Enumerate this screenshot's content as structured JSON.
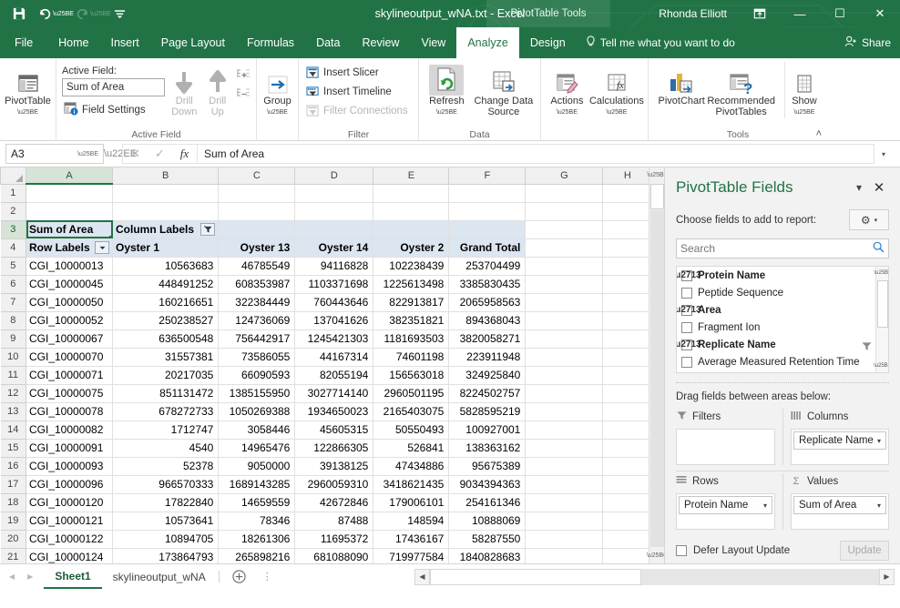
{
  "titlebar": {
    "quick_access": [
      {
        "name": "save-icon",
        "glyph": "💾",
        "dim": false
      },
      {
        "name": "undo-icon",
        "glyph": "↶",
        "dim": false
      },
      {
        "name": "redo-icon",
        "glyph": "↷",
        "dim": true
      },
      {
        "name": "customize-qat-icon",
        "glyph": "☰",
        "dim": false
      }
    ],
    "document_title": "skylineoutput_wNA.txt  -  Excel",
    "contextual_tools": "PivotTable Tools",
    "user_name": "Rhonda Elliott",
    "ribbon_display_icon": "⬒",
    "minimize": "—",
    "maximize": "☐",
    "close": "✕"
  },
  "ribbon_tabs": {
    "items": [
      {
        "label": "File",
        "active": false
      },
      {
        "label": "Home",
        "active": false
      },
      {
        "label": "Insert",
        "active": false
      },
      {
        "label": "Page Layout",
        "active": false
      },
      {
        "label": "Formulas",
        "active": false
      },
      {
        "label": "Data",
        "active": false
      },
      {
        "label": "Review",
        "active": false
      },
      {
        "label": "View",
        "active": false
      },
      {
        "label": "Analyze",
        "active": true
      },
      {
        "label": "Design",
        "active": false
      }
    ],
    "tell_me": "Tell me what you want to do",
    "share": "Share"
  },
  "ribbon": {
    "groups": [
      {
        "title": "",
        "name": "pivottable-group"
      },
      {
        "title": "Active Field",
        "name": "active-field-group"
      },
      {
        "title": "",
        "name": "group-group"
      },
      {
        "title": "Filter",
        "name": "filter-group"
      },
      {
        "title": "Data",
        "name": "data-group"
      },
      {
        "title": "",
        "name": "actions-group"
      },
      {
        "title": "Tools",
        "name": "tools-group"
      }
    ],
    "pivottable_button": "PivotTable",
    "active_field_label": "Active Field:",
    "active_field_value": "Sum of Area",
    "field_settings": "Field Settings",
    "drill_down": "Drill\nDown",
    "drill_down_l1": "Drill",
    "drill_down_l2": "Down",
    "drill_up_l1": "Drill",
    "drill_up_l2": "Up",
    "group_button": "Group",
    "insert_slicer": "Insert Slicer",
    "insert_timeline": "Insert Timeline",
    "filter_connections": "Filter Connections",
    "refresh": "Refresh",
    "change_data_source_l1": "Change Data",
    "change_data_source_l2": "Source",
    "actions": "Actions",
    "calculations": "Calculations",
    "pivotchart": "PivotChart",
    "recommended_l1": "Recommended",
    "recommended_l2": "PivotTables",
    "show": "Show",
    "collapse_icon": "˄"
  },
  "formula_bar": {
    "name_box_value": "A3",
    "cancel_icon": "✕",
    "enter_icon": "✓",
    "fx_icon": "fx",
    "formula_value": "Sum of Area",
    "dropdown_icon": "▾"
  },
  "grid": {
    "columns": [
      "A",
      "B",
      "C",
      "D",
      "E",
      "F",
      "G",
      "H"
    ],
    "selected_column": "A",
    "selected_row": 3,
    "active_cell": "A3",
    "rows": [
      {
        "n": 1,
        "cells": [
          "",
          "",
          "",
          "",
          "",
          "",
          "",
          ""
        ]
      },
      {
        "n": 2,
        "cells": [
          "",
          "",
          "",
          "",
          "",
          "",
          "",
          ""
        ]
      },
      {
        "n": 3,
        "cells": [
          "Sum of Area",
          "Column Labels",
          "",
          "",
          "",
          "",
          "",
          ""
        ]
      },
      {
        "n": 4,
        "cells": [
          "Row Labels",
          "Oyster 1",
          "Oyster 13",
          "Oyster 14",
          "Oyster 2",
          "Grand Total",
          "",
          ""
        ]
      },
      {
        "n": 5,
        "cells": [
          "CGI_10000013",
          "10563683",
          "46785549",
          "94116828",
          "102238439",
          "253704499",
          "",
          ""
        ]
      },
      {
        "n": 6,
        "cells": [
          "CGI_10000045",
          "448491252",
          "608353987",
          "1103371698",
          "1225613498",
          "3385830435",
          "",
          ""
        ]
      },
      {
        "n": 7,
        "cells": [
          "CGI_10000050",
          "160216651",
          "322384449",
          "760443646",
          "822913817",
          "2065958563",
          "",
          ""
        ]
      },
      {
        "n": 8,
        "cells": [
          "CGI_10000052",
          "250238527",
          "124736069",
          "137041626",
          "382351821",
          "894368043",
          "",
          ""
        ]
      },
      {
        "n": 9,
        "cells": [
          "CGI_10000067",
          "636500548",
          "756442917",
          "1245421303",
          "1181693503",
          "3820058271",
          "",
          ""
        ]
      },
      {
        "n": 10,
        "cells": [
          "CGI_10000070",
          "31557381",
          "73586055",
          "44167314",
          "74601198",
          "223911948",
          "",
          ""
        ]
      },
      {
        "n": 11,
        "cells": [
          "CGI_10000071",
          "20217035",
          "66090593",
          "82055194",
          "156563018",
          "324925840",
          "",
          ""
        ]
      },
      {
        "n": 12,
        "cells": [
          "CGI_10000075",
          "851131472",
          "1385155950",
          "3027714140",
          "2960501195",
          "8224502757",
          "",
          ""
        ]
      },
      {
        "n": 13,
        "cells": [
          "CGI_10000078",
          "678272733",
          "1050269388",
          "1934650023",
          "2165403075",
          "5828595219",
          "",
          ""
        ]
      },
      {
        "n": 14,
        "cells": [
          "CGI_10000082",
          "1712747",
          "3058446",
          "45605315",
          "50550493",
          "100927001",
          "",
          ""
        ]
      },
      {
        "n": 15,
        "cells": [
          "CGI_10000091",
          "4540",
          "14965476",
          "122866305",
          "526841",
          "138363162",
          "",
          ""
        ]
      },
      {
        "n": 16,
        "cells": [
          "CGI_10000093",
          "52378",
          "9050000",
          "39138125",
          "47434886",
          "95675389",
          "",
          ""
        ]
      },
      {
        "n": 17,
        "cells": [
          "CGI_10000096",
          "966570333",
          "1689143285",
          "2960059310",
          "3418621435",
          "9034394363",
          "",
          ""
        ]
      },
      {
        "n": 18,
        "cells": [
          "CGI_10000120",
          "17822840",
          "14659559",
          "42672846",
          "179006101",
          "254161346",
          "",
          ""
        ]
      },
      {
        "n": 19,
        "cells": [
          "CGI_10000121",
          "10573641",
          "78346",
          "87488",
          "148594",
          "10888069",
          "",
          ""
        ]
      },
      {
        "n": 20,
        "cells": [
          "CGI_10000122",
          "10894705",
          "18261306",
          "11695372",
          "17436167",
          "58287550",
          "",
          ""
        ]
      },
      {
        "n": 21,
        "cells": [
          "CGI_10000124",
          "173864793",
          "265898216",
          "681088090",
          "719977584",
          "1840828683",
          "",
          ""
        ]
      }
    ],
    "filter_icon": "∇"
  },
  "pane": {
    "title": "PivotTable Fields",
    "menu_icon": "▾",
    "close_icon": "✕",
    "choose_label": "Choose fields to add to report:",
    "gear_icon": "⚙",
    "gear_caret": "▾",
    "search_placeholder": "Search",
    "search_icon": "⌕",
    "fields": [
      {
        "label": "Protein Name",
        "checked": true
      },
      {
        "label": "Peptide Sequence",
        "checked": false
      },
      {
        "label": "Area",
        "checked": true
      },
      {
        "label": "Fragment Ion",
        "checked": false
      },
      {
        "label": "Replicate Name",
        "checked": true
      },
      {
        "label": "Average Measured Retention Time",
        "checked": false
      }
    ],
    "check_glyph": "✓",
    "drag_label": "Drag fields between areas below:",
    "areas": [
      {
        "name": "Filters",
        "icon": "∇",
        "items": []
      },
      {
        "name": "Columns",
        "icon": "‖‖",
        "items": [
          "Replicate Name"
        ]
      },
      {
        "name": "Rows",
        "icon": "≡",
        "items": [
          "Protein Name"
        ]
      },
      {
        "name": "Values",
        "icon": "Σ",
        "items": [
          "Sum of Area"
        ]
      }
    ],
    "pill_caret": "▾",
    "defer_label": "Defer Layout Update",
    "update_button": "Update"
  },
  "sheetbar": {
    "prev_icon": "◀",
    "next_icon": "▶",
    "tabs": [
      {
        "label": "Sheet1",
        "active": true
      },
      {
        "label": "skylineoutput_wNA",
        "active": false
      }
    ],
    "add_sheet_icon": "⊕",
    "more_icon": "⋮",
    "hscroll_left": "◀",
    "hscroll_right": "▶"
  },
  "colors": {
    "excel_green": "#217346",
    "pivot_header_blue": "#dce6f1",
    "selection_green": "#217346"
  }
}
